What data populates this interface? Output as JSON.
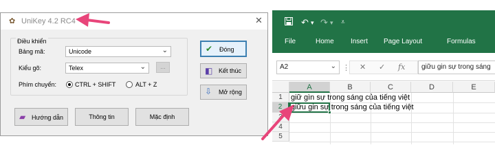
{
  "unikey": {
    "title": "UniKey 4.2 RC4",
    "close_glyph": "✕",
    "group_label": "Điều khiển",
    "charset_label": "Bảng mã:",
    "charset_value": "Unicode",
    "input_label": "Kiểu gõ:",
    "input_value": "Telex",
    "input_more": "...",
    "switch_label": "Phím chuyển:",
    "switch_opt1": "CTRL + SHIFT",
    "switch_opt2": "ALT + Z",
    "switch_selected": "CTRL + SHIFT",
    "close_btn": "Đóng",
    "exit_btn": "Kết thúc",
    "expand_btn": "Mở rộng",
    "help_btn": "Hướng dẫn",
    "info_btn": "Thông tin",
    "default_btn": "Mặc định"
  },
  "excel": {
    "quick_access": [
      "save-icon",
      "undo-icon",
      "redo-icon",
      "customize-icon"
    ],
    "tabs": [
      "File",
      "Home",
      "Insert",
      "Page Layout",
      "Formulas"
    ],
    "name_box": "A2",
    "formula_content": "giữu gin sự trong sáng",
    "fx_label": "fx",
    "columns": [
      "A",
      "B",
      "C",
      "D",
      "E"
    ],
    "rows": [
      "1",
      "2",
      "3",
      "4",
      "5"
    ],
    "cell_a1": "giữ gìn sự trong sáng của tiếng việt",
    "cell_a2": "giữu gin sự trong sáng của tiếng việt",
    "selected_cell": "A2"
  },
  "colors": {
    "excel_green": "#217346",
    "arrow_pink": "#e8457a",
    "default_button_border": "#3c7fb1"
  }
}
